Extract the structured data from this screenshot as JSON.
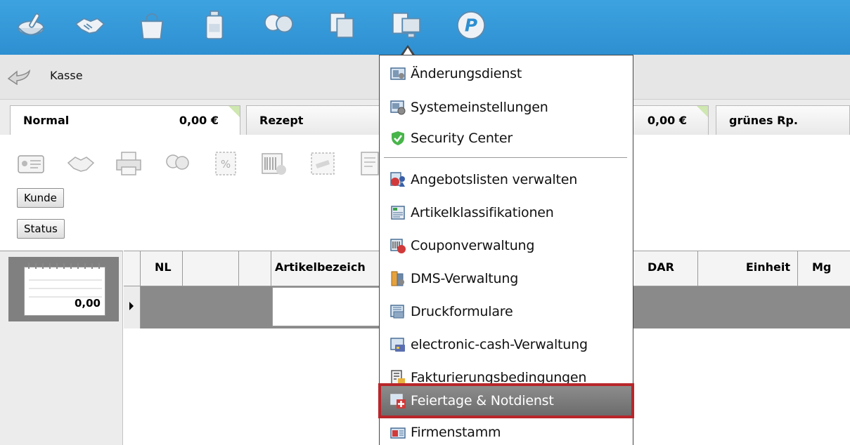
{
  "colors": {
    "toolbar_blue": "#2e8fd1",
    "menu_highlight": "#7a7a7a",
    "highlight_border": "#b8262a"
  },
  "toolbar": {
    "icons": [
      "mortar-icon",
      "handshake-icon",
      "bag-icon",
      "medicine-bottle-icon",
      "people-icon",
      "documents-icon",
      "computer-settings-icon",
      "pharmacy-p-icon"
    ]
  },
  "breadcrumb": {
    "label": "Kasse"
  },
  "tabs": [
    {
      "name": "Normal",
      "amount": "0,00 €"
    },
    {
      "name": "Rezept",
      "amount": ""
    },
    {
      "name": "",
      "amount": "0,00 €"
    },
    {
      "name": "grünes Rp.",
      "amount": ""
    }
  ],
  "actions": {
    "icons": [
      "id-card-icon",
      "handshake-icon",
      "printer-icon",
      "customers-icon",
      "percent-icon",
      "barcode-icon",
      "coupon-icon",
      "document-icon"
    ],
    "buttons": {
      "kunde": "Kunde",
      "status": "Status"
    }
  },
  "notepad": {
    "total": "0,00"
  },
  "grid": {
    "columns": [
      "NL",
      "",
      "",
      "Artikelbezeich",
      "DAR",
      "Einheit",
      "Mg"
    ]
  },
  "menu": {
    "items": [
      {
        "label": "Änderungsdienst",
        "icon": "update-service-icon"
      },
      {
        "label": "Systemeinstellungen",
        "icon": "system-settings-icon"
      },
      {
        "label": "Security Center",
        "icon": "shield-check-icon"
      },
      {
        "label": "Angebotslisten verwalten",
        "icon": "offer-lists-icon"
      },
      {
        "label": "Artikelklassifikationen",
        "icon": "article-classification-icon"
      },
      {
        "label": "Couponverwaltung",
        "icon": "coupon-icon"
      },
      {
        "label": "DMS-Verwaltung",
        "icon": "dms-icon"
      },
      {
        "label": "Druckformulare",
        "icon": "print-forms-icon"
      },
      {
        "label": "electronic-cash-Verwaltung",
        "icon": "electronic-cash-icon"
      },
      {
        "label": "Fakturierungsbedingungen",
        "icon": "billing-conditions-icon"
      },
      {
        "label": "Feiertage & Notdienst",
        "icon": "holiday-emergency-icon"
      },
      {
        "label": "Firmenstamm",
        "icon": "company-master-icon"
      }
    ],
    "highlighted": "Feiertage & Notdienst"
  }
}
